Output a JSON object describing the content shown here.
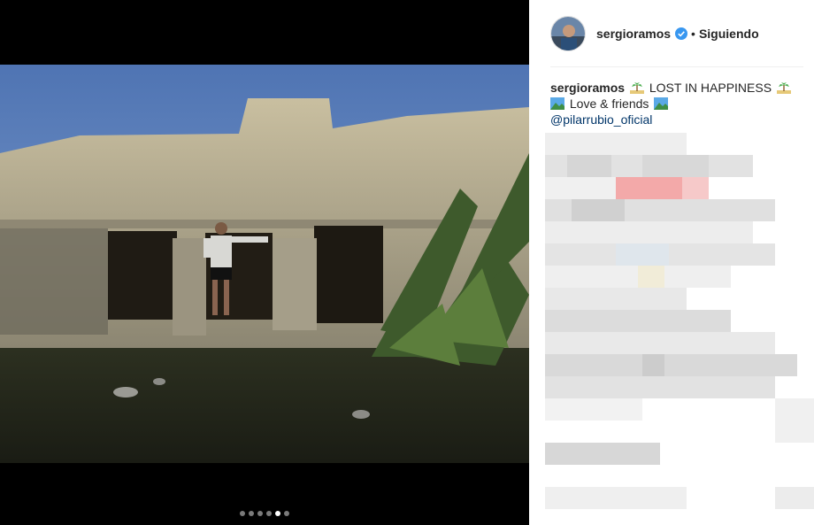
{
  "post": {
    "username": "sergioramos",
    "separator": "•",
    "follow_status": "Siguiendo",
    "caption": {
      "username": "sergioramos",
      "line1": "LOST IN HAPPINESS",
      "line2": "Love & friends",
      "mention": "@pilarrubio_oficial"
    },
    "emojis": [
      "palm-island-icon",
      "palm-island-icon",
      "landscape-icon",
      "landscape-icon"
    ],
    "carousel": {
      "total": 6,
      "active": 5
    }
  },
  "colors": {
    "accent": "#3897f0",
    "text": "#262626",
    "link": "#003569"
  }
}
